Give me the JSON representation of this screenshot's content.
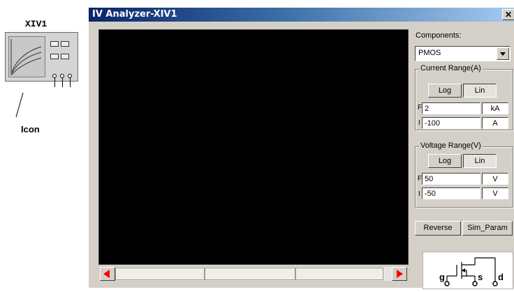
{
  "instrument_icon": {
    "name": "XIV1",
    "callout_label": "Icon"
  },
  "window": {
    "title": "IV Analyzer-XIV1",
    "close_glyph": "✕",
    "components": {
      "label": "Components:",
      "selected": "PMOS"
    },
    "current_range": {
      "title": "Current Range(A)",
      "log_label": "Log",
      "lin_label": "Lin",
      "final_prefix": "F",
      "final_value": "2",
      "final_unit": "kA",
      "initial_prefix": "I",
      "initial_value": "-100",
      "initial_unit": "A"
    },
    "voltage_range": {
      "title": "Voltage Range(V)",
      "log_label": "Log",
      "lin_label": "Lin",
      "final_prefix": "F",
      "final_value": "50",
      "final_unit": "V",
      "initial_prefix": "I",
      "initial_value": "-50",
      "initial_unit": "V"
    },
    "buttons": {
      "reverse": "Reverse",
      "sim_param": "Sim_Param"
    },
    "symbol": {
      "gate": "g",
      "source": "s",
      "drain": "d"
    }
  },
  "colors": {
    "plot_bg": "#000000",
    "window_bg": "#d4d0c8",
    "titlebar": "#0a246a",
    "scroll_arrow": "#ff0000"
  }
}
